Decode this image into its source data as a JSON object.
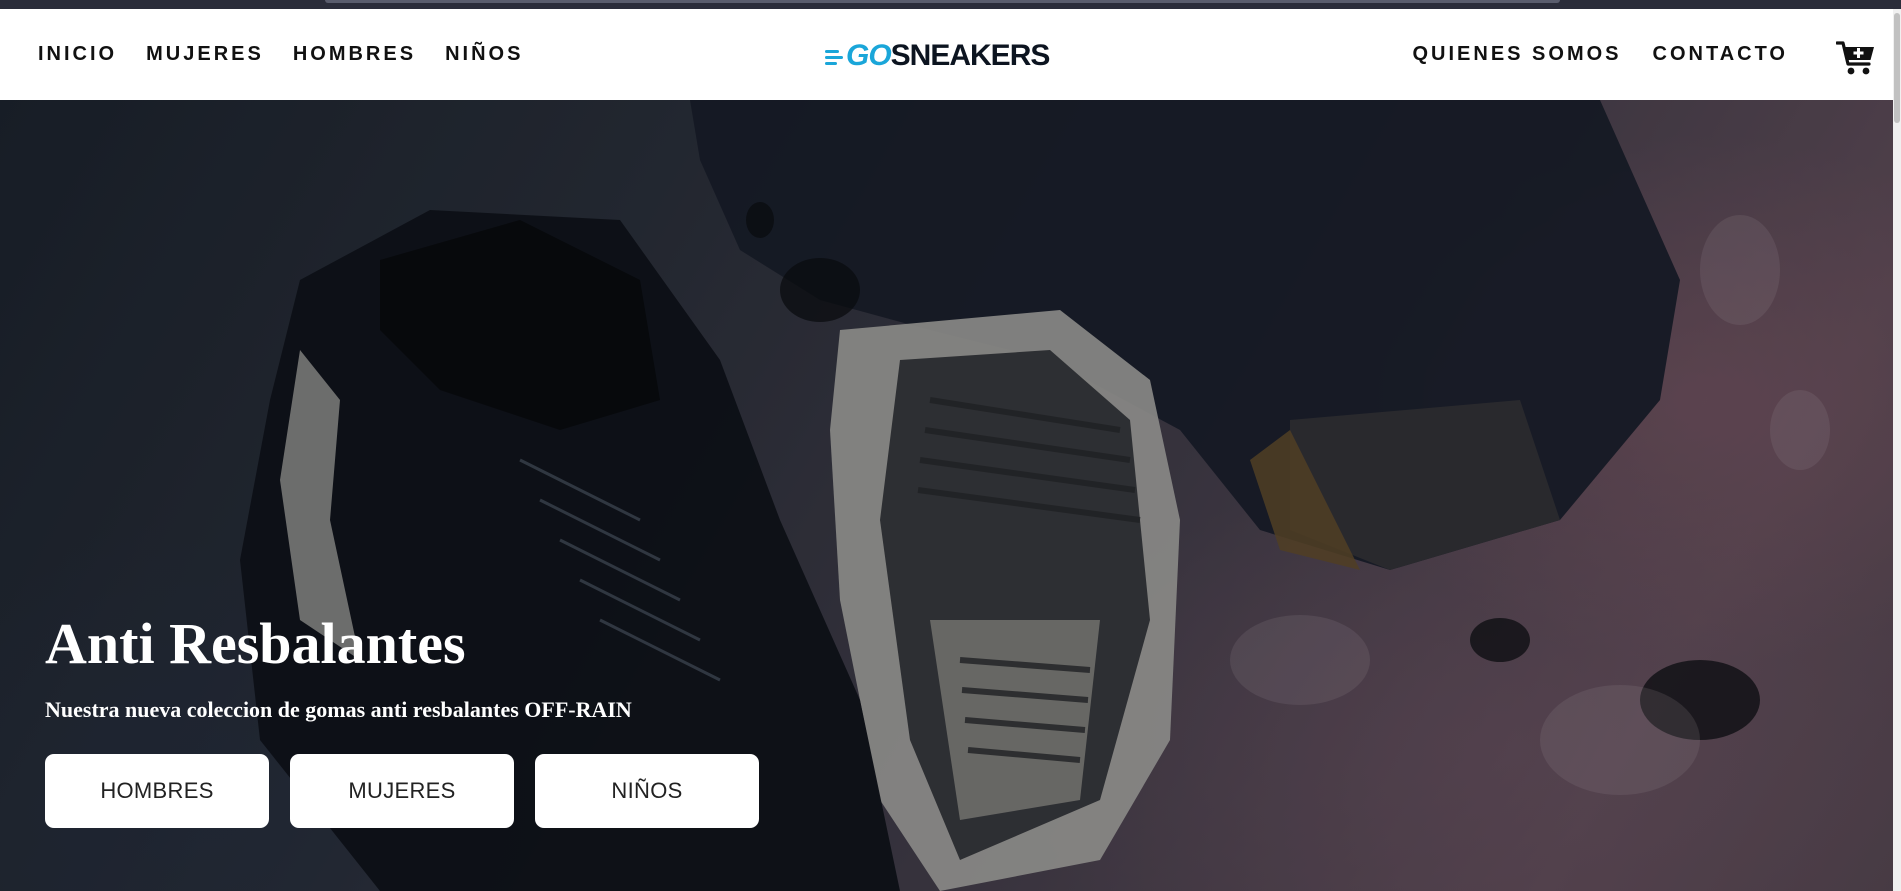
{
  "header": {
    "nav_left": [
      "INICIO",
      "MUJERES",
      "HOMBRES",
      "NIÑOS"
    ],
    "nav_right": [
      "QUIENES SOMOS",
      "CONTACTO"
    ],
    "logo": {
      "go": "GO",
      "sneakers": "SNEAKERS"
    },
    "cart_icon": "cart-plus-icon"
  },
  "hero": {
    "title": "Anti Resbalantes",
    "subtitle": "Nuestra nueva coleccion de gomas anti resbalantes OFF-RAIN",
    "buttons": [
      "HOMBRES",
      "MUJERES",
      "NIÑOS"
    ]
  },
  "colors": {
    "brand_blue": "#1aa6d9",
    "brand_dark": "#0c1420",
    "header_bg": "#ffffff",
    "button_bg": "#ffffff"
  }
}
